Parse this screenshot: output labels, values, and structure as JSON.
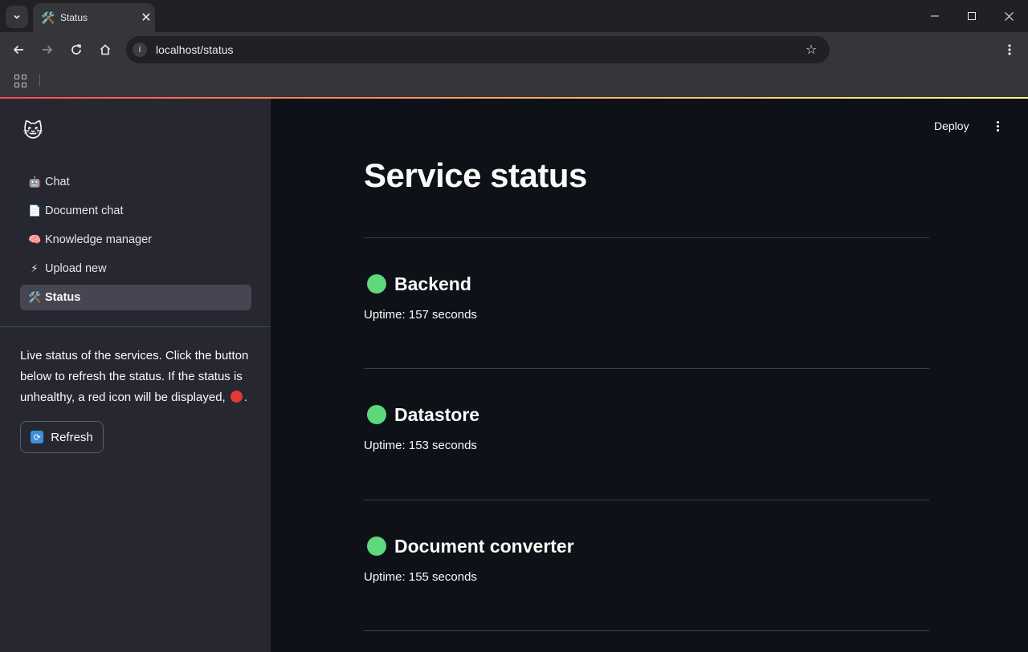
{
  "browser": {
    "tab_title": "Status",
    "tab_icon": "🛠️",
    "tab_close": "✕",
    "url": "localhost/status",
    "minimize": "—",
    "maximize": "☐",
    "close": "✕"
  },
  "sidebar": {
    "logo_icon": "🐱",
    "items": [
      {
        "icon": "🤖",
        "label": "Chat"
      },
      {
        "icon": "📄",
        "label": "Document chat"
      },
      {
        "icon": "🧠",
        "label": "Knowledge manager"
      },
      {
        "icon": "⚡",
        "label": "Upload new"
      },
      {
        "icon": "🛠️",
        "label": "Status",
        "active": true
      }
    ],
    "description_before": "Live status of the services. Click the button below to refresh the status. If the status is unhealthy, a red icon will be displayed,",
    "description_after": ".",
    "refresh_icon": "🔄",
    "refresh_label": "Refresh"
  },
  "header": {
    "deploy_label": "Deploy"
  },
  "main": {
    "title": "Service status",
    "services": [
      {
        "name": "Backend",
        "uptime": "Uptime: 157 seconds",
        "status": "healthy"
      },
      {
        "name": "Datastore",
        "uptime": "Uptime: 153 seconds",
        "status": "healthy"
      },
      {
        "name": "Document converter",
        "uptime": "Uptime: 155 seconds",
        "status": "healthy"
      }
    ]
  },
  "colors": {
    "healthy": "#5dd87a",
    "unhealthy": "#e53935",
    "sidebar_bg": "#262730",
    "main_bg": "#0e1117"
  }
}
